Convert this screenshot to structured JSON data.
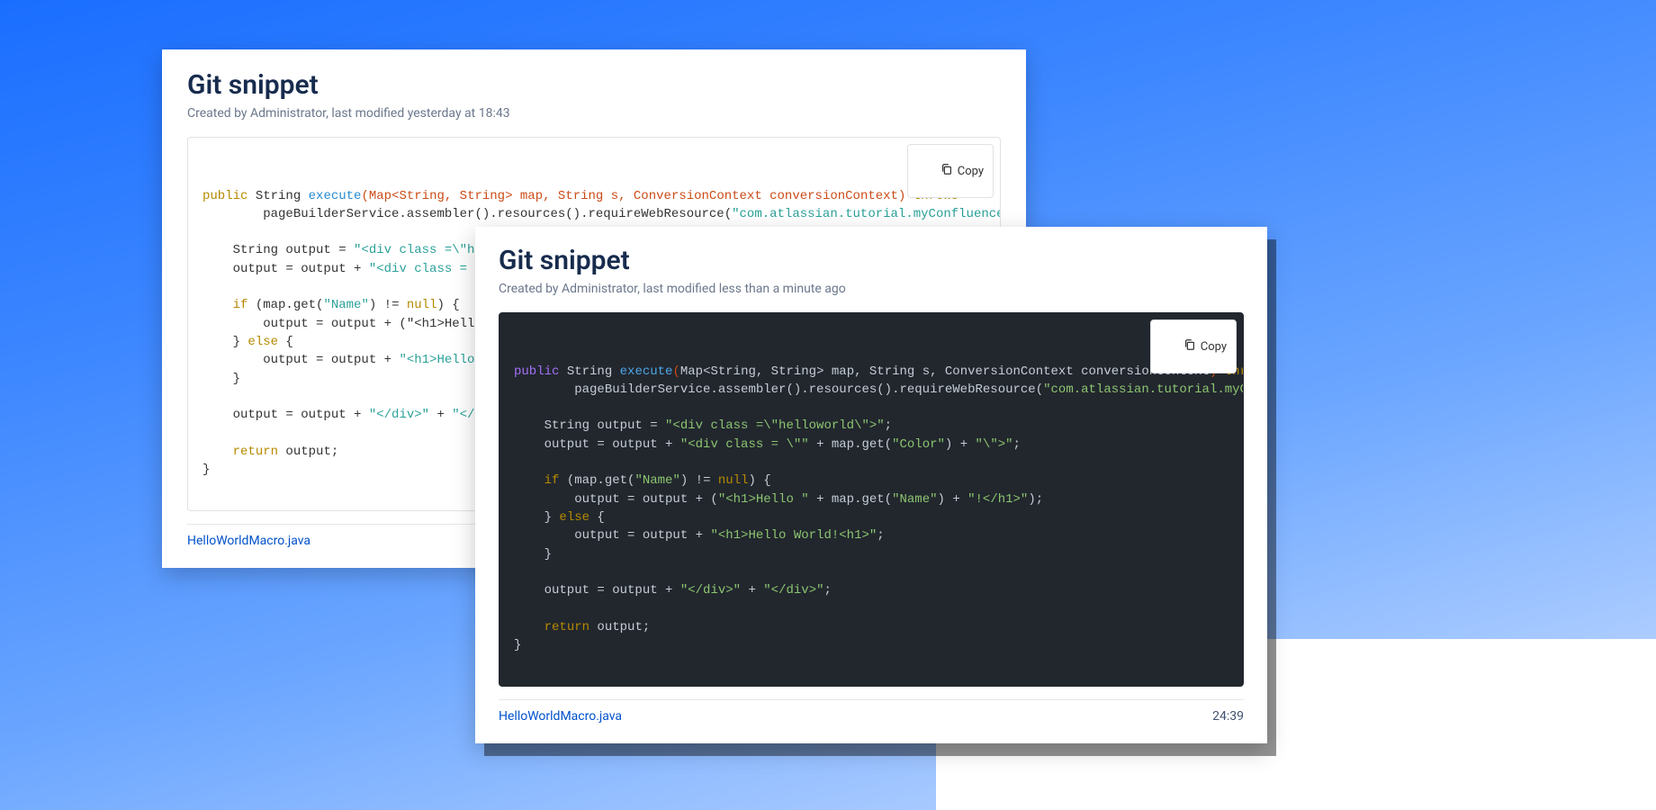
{
  "cards": {
    "light": {
      "title": "Git snippet",
      "meta": "Created by Administrator, last modified yesterday at 18:43",
      "copy_label": "Copy",
      "file_link": "HelloWorldMacro.java"
    },
    "dark": {
      "title": "Git snippet",
      "meta": "Created by Administrator, last modified less than a minute ago",
      "copy_label": "Copy",
      "file_link": "HelloWorldMacro.java",
      "timestamp": "24:39"
    }
  },
  "code": {
    "line1_public": "public",
    "line1_type": " String ",
    "line1_fn": "execute",
    "line1_sig_open": "(",
    "line1_sig_in": "Map<String, String> map, String s, ConversionContext conversionContext",
    "line1_sig_close": ")",
    "line1_throws": " throws ",
    "line2": "        pageBuilderService.assembler().resources().requireWebResource(",
    "line2_str": "\"com.atlassian.tutorial.myConfluenceMacro:",
    "line2_dark_str": "\"com.atlassian.tutorial.myConfluenceMacro:my",
    "blank": "",
    "l3a": "    String output = ",
    "l3s": "\"<div class =\\\"helloworld\\\">\"",
    "l3e": ";",
    "l4a": "    output = output + ",
    "l4s_light": "\"<div class = \\",
    "l4s1": "\"<div class = \\\"\"",
    "l4m": " + map.get(",
    "l4s2": "\"Color\"",
    "l4m2": ") + ",
    "l4s3": "\"\\\">\"",
    "l4e": ";",
    "ifkw": "if",
    "l5a": "    ",
    "l5b": " (map.get(",
    "l5s": "\"Name\"",
    "l5c": ") != ",
    "nullkw": "null",
    "l5d": ") {",
    "l6a": "        output = output + (",
    "l6s1": "\"<h1>Hello \"",
    "l6m": " + map.get(",
    "l6s2": "\"Name\"",
    "l6m2": ") + ",
    "l6s3": "\"!</h1>\"",
    "l6e": ");",
    "l6light": "        output = output + (\"<h1>Hello",
    "elsekw": "else",
    "l7a": "    } ",
    "l7b": " {",
    "l8a": "        output = output + ",
    "l8s": "\"<h1>Hello World!<h1>\"",
    "l8e": ";",
    "l8light_a": "        output = output + ",
    "l8light_s": "\"<h1>Hello ",
    "l9": "    }",
    "l10a": "    output = output + ",
    "l10s1": "\"</div>\"",
    "l10m": " + ",
    "l10s2": "\"</div>\"",
    "l10e": ";",
    "l10light_a": "    output = output + ",
    "l10light_s": "\"</div>\"",
    "l10light_m": " + ",
    "l10light_s2": "\"</di",
    "retkw": "return",
    "l11a": "    ",
    "l11b": " output;",
    "l12": "}"
  }
}
